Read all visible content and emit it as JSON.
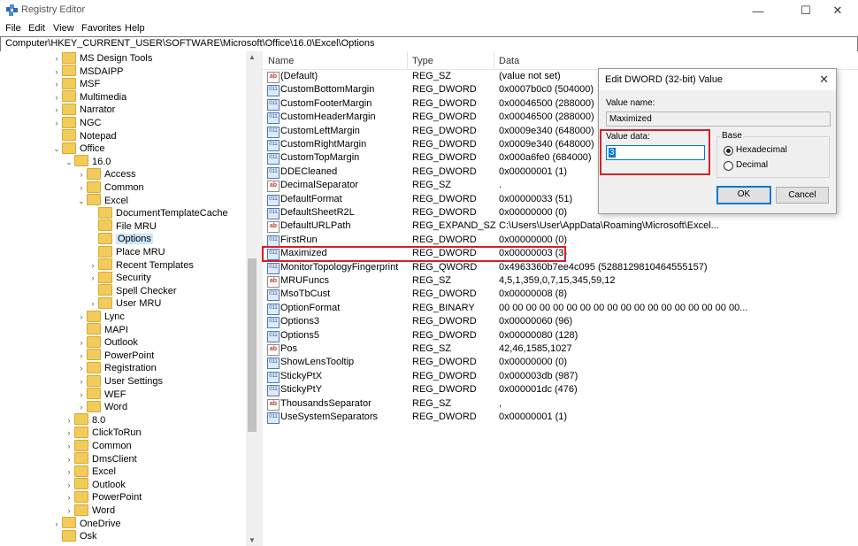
{
  "window": {
    "title": "Registry Editor"
  },
  "menu": [
    "File",
    "Edit",
    "View",
    "Favorites",
    "Help"
  ],
  "address": "Computer\\HKEY_CURRENT_USER\\SOFTWARE\\Microsoft\\Office\\16.0\\Excel\\Options",
  "tree": [
    {
      "label": "MS Design Tools",
      "depth": 0,
      "chev": "›"
    },
    {
      "label": "MSDAIPP",
      "depth": 0,
      "chev": "›"
    },
    {
      "label": "MSF",
      "depth": 0,
      "chev": "›"
    },
    {
      "label": "Multimedia",
      "depth": 0,
      "chev": "›"
    },
    {
      "label": "Narrator",
      "depth": 0,
      "chev": "›"
    },
    {
      "label": "NGC",
      "depth": 0,
      "chev": "›"
    },
    {
      "label": "Notepad",
      "depth": 0,
      "chev": ""
    },
    {
      "label": "Office",
      "depth": 0,
      "chev": "⌄"
    },
    {
      "label": "16.0",
      "depth": 1,
      "chev": "⌄"
    },
    {
      "label": "Access",
      "depth": 2,
      "chev": "›"
    },
    {
      "label": "Common",
      "depth": 2,
      "chev": "›"
    },
    {
      "label": "Excel",
      "depth": 2,
      "chev": "⌄"
    },
    {
      "label": "DocumentTemplateCache",
      "depth": 3,
      "chev": ""
    },
    {
      "label": "File MRU",
      "depth": 3,
      "chev": ""
    },
    {
      "label": "Options",
      "depth": 3,
      "chev": "",
      "selected": true
    },
    {
      "label": "Place MRU",
      "depth": 3,
      "chev": ""
    },
    {
      "label": "Recent Templates",
      "depth": 3,
      "chev": "›"
    },
    {
      "label": "Security",
      "depth": 3,
      "chev": "›"
    },
    {
      "label": "Spell Checker",
      "depth": 3,
      "chev": ""
    },
    {
      "label": "User MRU",
      "depth": 3,
      "chev": "›"
    },
    {
      "label": "Lync",
      "depth": 2,
      "chev": "›"
    },
    {
      "label": "MAPI",
      "depth": 2,
      "chev": ""
    },
    {
      "label": "Outlook",
      "depth": 2,
      "chev": "›"
    },
    {
      "label": "PowerPoint",
      "depth": 2,
      "chev": "›"
    },
    {
      "label": "Registration",
      "depth": 2,
      "chev": "›"
    },
    {
      "label": "User Settings",
      "depth": 2,
      "chev": "›"
    },
    {
      "label": "WEF",
      "depth": 2,
      "chev": "›"
    },
    {
      "label": "Word",
      "depth": 2,
      "chev": "›"
    },
    {
      "label": "8.0",
      "depth": 1,
      "chev": "›"
    },
    {
      "label": "ClickToRun",
      "depth": 1,
      "chev": "›"
    },
    {
      "label": "Common",
      "depth": 1,
      "chev": "›"
    },
    {
      "label": "DmsClient",
      "depth": 1,
      "chev": "›"
    },
    {
      "label": "Excel",
      "depth": 1,
      "chev": "›"
    },
    {
      "label": "Outlook",
      "depth": 1,
      "chev": "›"
    },
    {
      "label": "PowerPoint",
      "depth": 1,
      "chev": "›"
    },
    {
      "label": "Word",
      "depth": 1,
      "chev": "›"
    },
    {
      "label": "OneDrive",
      "depth": 0,
      "chev": "›"
    },
    {
      "label": "Osk",
      "depth": 0,
      "chev": ""
    }
  ],
  "columns": {
    "name": "Name",
    "type": "Type",
    "data": "Data"
  },
  "values": [
    {
      "name": "(Default)",
      "type": "REG_SZ",
      "data": "(value not set)",
      "icon": "sz"
    },
    {
      "name": "CustomBottomMargin",
      "type": "REG_DWORD",
      "data": "0x0007b0c0 (504000)",
      "icon": "bin"
    },
    {
      "name": "CustomFooterMargin",
      "type": "REG_DWORD",
      "data": "0x00046500 (288000)",
      "icon": "bin"
    },
    {
      "name": "CustomHeaderMargin",
      "type": "REG_DWORD",
      "data": "0x00046500 (288000)",
      "icon": "bin"
    },
    {
      "name": "CustomLeftMargin",
      "type": "REG_DWORD",
      "data": "0x0009e340 (648000)",
      "icon": "bin"
    },
    {
      "name": "CustomRightMargin",
      "type": "REG_DWORD",
      "data": "0x0009e340 (648000)",
      "icon": "bin"
    },
    {
      "name": "CustomTopMargin",
      "type": "REG_DWORD",
      "data": "0x000a6fe0 (684000)",
      "icon": "bin"
    },
    {
      "name": "DDECleaned",
      "type": "REG_DWORD",
      "data": "0x00000001 (1)",
      "icon": "bin"
    },
    {
      "name": "DecimalSeparator",
      "type": "REG_SZ",
      "data": ".",
      "icon": "sz"
    },
    {
      "name": "DefaultFormat",
      "type": "REG_DWORD",
      "data": "0x00000033 (51)",
      "icon": "bin"
    },
    {
      "name": "DefaultSheetR2L",
      "type": "REG_DWORD",
      "data": "0x00000000 (0)",
      "icon": "bin"
    },
    {
      "name": "DefaultURLPath",
      "type": "REG_EXPAND_SZ",
      "data": "C:\\Users\\User\\AppData\\Roaming\\Microsoft\\Excel...",
      "icon": "sz"
    },
    {
      "name": "FirstRun",
      "type": "REG_DWORD",
      "data": "0x00000000 (0)",
      "icon": "bin"
    },
    {
      "name": "Maximized",
      "type": "REG_DWORD",
      "data": "0x00000003 (3)",
      "icon": "bin"
    },
    {
      "name": "MonitorTopologyFingerprint",
      "type": "REG_QWORD",
      "data": "0x4963360b7ee4c095 (5288129810464555157)",
      "icon": "bin"
    },
    {
      "name": "MRUFuncs",
      "type": "REG_SZ",
      "data": "4,5,1,359,0,7,15,345,59,12",
      "icon": "sz"
    },
    {
      "name": "MsoTbCust",
      "type": "REG_DWORD",
      "data": "0x00000008 (8)",
      "icon": "bin"
    },
    {
      "name": "OptionFormat",
      "type": "REG_BINARY",
      "data": "00 00 00 00 00 00 00 00 00 00 00 00 00 00 00 00 00 00...",
      "icon": "bin"
    },
    {
      "name": "Options3",
      "type": "REG_DWORD",
      "data": "0x00000060 (96)",
      "icon": "bin"
    },
    {
      "name": "Options5",
      "type": "REG_DWORD",
      "data": "0x00000080 (128)",
      "icon": "bin"
    },
    {
      "name": "Pos",
      "type": "REG_SZ",
      "data": "42,46,1585,1027",
      "icon": "sz"
    },
    {
      "name": "ShowLensTooltip",
      "type": "REG_DWORD",
      "data": "0x00000000 (0)",
      "icon": "bin"
    },
    {
      "name": "StickyPtX",
      "type": "REG_DWORD",
      "data": "0x000003db (987)",
      "icon": "bin"
    },
    {
      "name": "StickyPtY",
      "type": "REG_DWORD",
      "data": "0x000001dc (476)",
      "icon": "bin"
    },
    {
      "name": "ThousandsSeparator",
      "type": "REG_SZ",
      "data": ",",
      "icon": "sz"
    },
    {
      "name": "UseSystemSeparators",
      "type": "REG_DWORD",
      "data": "0x00000001 (1)",
      "icon": "bin"
    }
  ],
  "dialog": {
    "title": "Edit DWORD (32-bit) Value",
    "value_name_label": "Value name:",
    "value_name": "Maximized",
    "value_data_label": "Value data:",
    "value_data": "3",
    "base_label": "Base",
    "hex_label": "Hexadecimal",
    "dec_label": "Decimal",
    "selected_base": "Hexadecimal",
    "ok_label": "OK",
    "cancel_label": "Cancel"
  },
  "icons": {
    "sz": "ab",
    "bin": "011"
  },
  "colors": {
    "highlight_border": "#d61f26",
    "selection": "#cce8ff",
    "accent": "#0078d7"
  }
}
